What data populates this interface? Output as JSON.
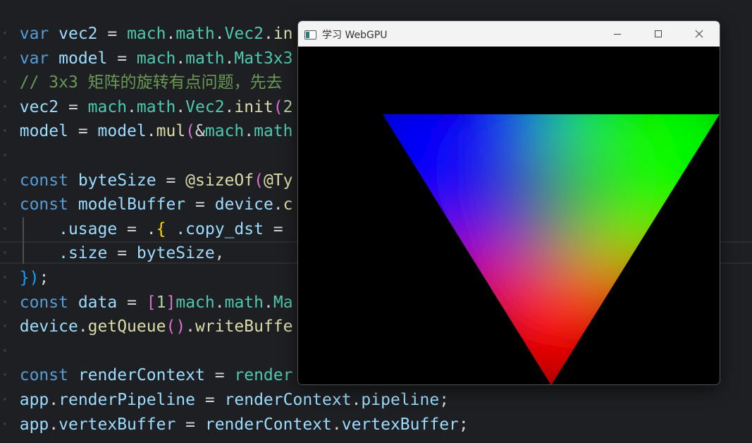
{
  "editor": {
    "lines": [
      {
        "tokens": [
          {
            "t": "var",
            "c": "kw"
          },
          {
            "t": " ",
            "c": "ws"
          },
          {
            "t": "vec2",
            "c": "id"
          },
          {
            "t": " = ",
            "c": "op"
          },
          {
            "t": "mach",
            "c": "ty"
          },
          {
            "t": ".",
            "c": "op"
          },
          {
            "t": "math",
            "c": "ty"
          },
          {
            "t": ".",
            "c": "op"
          },
          {
            "t": "Vec2",
            "c": "ty"
          },
          {
            "t": ".",
            "c": "op"
          },
          {
            "t": "in",
            "c": "fn"
          }
        ]
      },
      {
        "tokens": [
          {
            "t": "var",
            "c": "kw"
          },
          {
            "t": " ",
            "c": "ws"
          },
          {
            "t": "model",
            "c": "id"
          },
          {
            "t": " = ",
            "c": "op"
          },
          {
            "t": "mach",
            "c": "ty"
          },
          {
            "t": ".",
            "c": "op"
          },
          {
            "t": "math",
            "c": "ty"
          },
          {
            "t": ".",
            "c": "op"
          },
          {
            "t": "Mat3x3",
            "c": "ty"
          }
        ]
      },
      {
        "tokens": [
          {
            "t": "// 3x3 矩阵的旋转有点问题，先去",
            "c": "cm"
          }
        ]
      },
      {
        "tokens": [
          {
            "t": "vec2",
            "c": "id"
          },
          {
            "t": " = ",
            "c": "op"
          },
          {
            "t": "mach",
            "c": "ty"
          },
          {
            "t": ".",
            "c": "op"
          },
          {
            "t": "math",
            "c": "ty"
          },
          {
            "t": ".",
            "c": "op"
          },
          {
            "t": "Vec2",
            "c": "ty"
          },
          {
            "t": ".",
            "c": "op"
          },
          {
            "t": "init",
            "c": "fn"
          },
          {
            "t": "(",
            "c": "br2"
          },
          {
            "t": "2",
            "c": "nu"
          }
        ]
      },
      {
        "tokens": [
          {
            "t": "model",
            "c": "id"
          },
          {
            "t": " = ",
            "c": "op"
          },
          {
            "t": "model",
            "c": "id"
          },
          {
            "t": ".",
            "c": "op"
          },
          {
            "t": "mul",
            "c": "fn"
          },
          {
            "t": "(",
            "c": "br2"
          },
          {
            "t": "&",
            "c": "op"
          },
          {
            "t": "mach",
            "c": "ty"
          },
          {
            "t": ".",
            "c": "op"
          },
          {
            "t": "math",
            "c": "ty"
          }
        ]
      },
      {
        "tokens": []
      },
      {
        "tokens": [
          {
            "t": "const",
            "c": "kw"
          },
          {
            "t": " ",
            "c": "ws"
          },
          {
            "t": "byteSize",
            "c": "id"
          },
          {
            "t": " = ",
            "c": "op"
          },
          {
            "t": "@sizeOf",
            "c": "fn"
          },
          {
            "t": "(",
            "c": "br2"
          },
          {
            "t": "@Ty",
            "c": "fn"
          }
        ]
      },
      {
        "tokens": [
          {
            "t": "const",
            "c": "kw"
          },
          {
            "t": " ",
            "c": "ws"
          },
          {
            "t": "modelBuffer",
            "c": "id"
          },
          {
            "t": " = ",
            "c": "op"
          },
          {
            "t": "device",
            "c": "id"
          },
          {
            "t": ".",
            "c": "op"
          },
          {
            "t": "c",
            "c": "fn"
          }
        ]
      },
      {
        "tokens": [
          {
            "t": "    .usage",
            "c": "id"
          },
          {
            "t": " = ",
            "c": "op"
          },
          {
            "t": ".",
            "c": "op"
          },
          {
            "t": "{",
            "c": "br1"
          },
          {
            "t": " ",
            "c": "ws"
          },
          {
            "t": ".copy_dst",
            "c": "id"
          },
          {
            "t": " = ",
            "c": "op"
          }
        ]
      },
      {
        "tokens": [
          {
            "t": "    .size",
            "c": "id"
          },
          {
            "t": " = ",
            "c": "op"
          },
          {
            "t": "byteSize",
            "c": "id"
          },
          {
            "t": ",",
            "c": "op"
          }
        ]
      },
      {
        "tokens": [
          {
            "t": "}",
            "c": "br3"
          },
          {
            "t": ")",
            "c": "br3"
          },
          {
            "t": ";",
            "c": "op"
          }
        ]
      },
      {
        "tokens": [
          {
            "t": "const",
            "c": "kw"
          },
          {
            "t": " ",
            "c": "ws"
          },
          {
            "t": "data",
            "c": "id"
          },
          {
            "t": " = ",
            "c": "op"
          },
          {
            "t": "[",
            "c": "br2"
          },
          {
            "t": "1",
            "c": "nu"
          },
          {
            "t": "]",
            "c": "br2"
          },
          {
            "t": "mach",
            "c": "ty"
          },
          {
            "t": ".",
            "c": "op"
          },
          {
            "t": "math",
            "c": "ty"
          },
          {
            "t": ".",
            "c": "op"
          },
          {
            "t": "Ma",
            "c": "ty"
          }
        ]
      },
      {
        "tokens": [
          {
            "t": "device",
            "c": "id"
          },
          {
            "t": ".",
            "c": "op"
          },
          {
            "t": "getQueue",
            "c": "fn"
          },
          {
            "t": "(",
            "c": "br2"
          },
          {
            "t": ")",
            "c": "br2"
          },
          {
            "t": ".",
            "c": "op"
          },
          {
            "t": "writeBuffe",
            "c": "fn"
          }
        ]
      },
      {
        "tokens": []
      },
      {
        "tokens": [
          {
            "t": "const",
            "c": "kw"
          },
          {
            "t": " ",
            "c": "ws"
          },
          {
            "t": "renderContext",
            "c": "id"
          },
          {
            "t": " = ",
            "c": "op"
          },
          {
            "t": "render",
            "c": "ty"
          }
        ]
      },
      {
        "tokens": [
          {
            "t": "app",
            "c": "id"
          },
          {
            "t": ".",
            "c": "op"
          },
          {
            "t": "renderPipeline",
            "c": "id"
          },
          {
            "t": " = ",
            "c": "op"
          },
          {
            "t": "renderContext",
            "c": "id"
          },
          {
            "t": ".",
            "c": "op"
          },
          {
            "t": "pipeline",
            "c": "id"
          },
          {
            "t": ";",
            "c": "op"
          }
        ]
      },
      {
        "tokens": [
          {
            "t": "app",
            "c": "id"
          },
          {
            "t": ".",
            "c": "op"
          },
          {
            "t": "vertexBuffer",
            "c": "id"
          },
          {
            "t": " = ",
            "c": "op"
          },
          {
            "t": "renderContext",
            "c": "id"
          },
          {
            "t": ".",
            "c": "op"
          },
          {
            "t": "vertexBuffer",
            "c": "id"
          },
          {
            "t": ";",
            "c": "op"
          }
        ]
      }
    ]
  },
  "window": {
    "title": "学习 WebGPU",
    "icons": {
      "app": "window-app-icon",
      "minimize": "minimize-icon",
      "maximize": "maximize-icon",
      "close": "close-icon"
    },
    "canvas": {
      "background": "#000000",
      "triangle_vertex_colors": {
        "top_left": "#0000ff",
        "top_right": "#00ff00",
        "bottom": "#ff0000"
      }
    }
  }
}
